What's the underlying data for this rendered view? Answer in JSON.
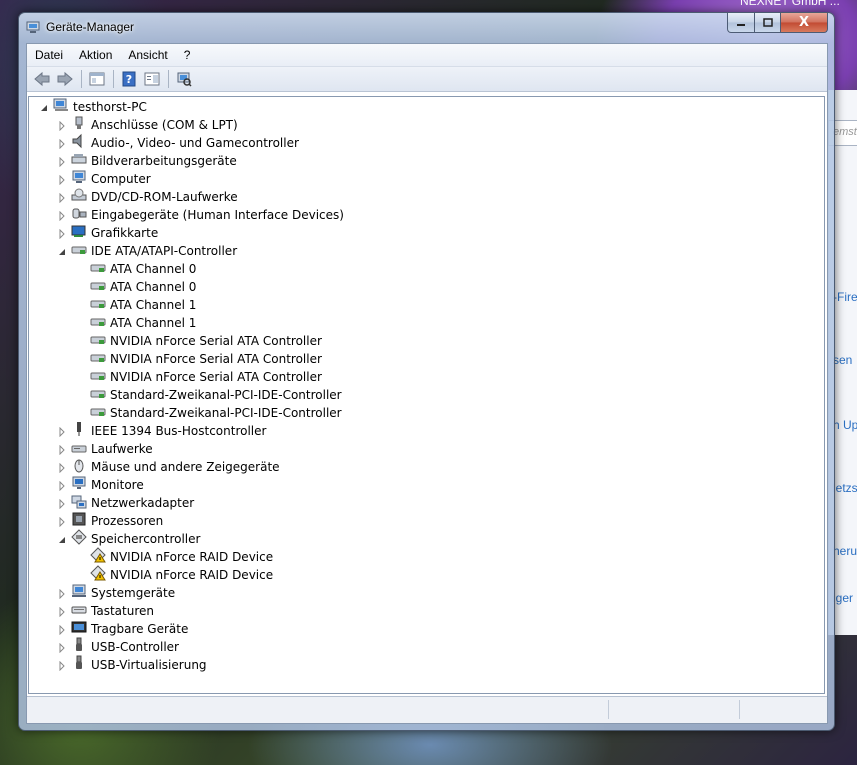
{
  "window": {
    "title": "Geräte-Manager",
    "caption_buttons": {
      "minimize": "–",
      "maximize": "□",
      "close": "X"
    }
  },
  "menu": [
    "Datei",
    "Aktion",
    "Ansicht",
    "?"
  ],
  "toolbar": {
    "buttons": [
      "back-arrow-icon",
      "forward-arrow-icon",
      "console-tree-icon",
      "help-icon",
      "properties-icon",
      "scan-hardware-icon"
    ]
  },
  "tree": {
    "root": "testhorst-PC",
    "items": [
      {
        "label": "Anschlüsse (COM & LPT)",
        "expanded": false,
        "icon": "port-icon",
        "children": []
      },
      {
        "label": "Audio-, Video- und Gamecontroller",
        "expanded": false,
        "icon": "speaker-icon",
        "children": []
      },
      {
        "label": "Bildverarbeitungsgeräte",
        "expanded": false,
        "icon": "scanner-icon",
        "children": []
      },
      {
        "label": "Computer",
        "expanded": false,
        "icon": "computer-icon",
        "children": []
      },
      {
        "label": "DVD/CD-ROM-Laufwerke",
        "expanded": false,
        "icon": "disc-drive-icon",
        "children": []
      },
      {
        "label": "Eingabegeräte (Human Interface Devices)",
        "expanded": false,
        "icon": "hid-icon",
        "children": []
      },
      {
        "label": "Grafikkarte",
        "expanded": false,
        "icon": "display-adapter-icon",
        "children": []
      },
      {
        "label": "IDE ATA/ATAPI-Controller",
        "expanded": true,
        "icon": "ide-controller-icon",
        "children": [
          "ATA Channel 0",
          "ATA Channel 0",
          "ATA Channel 1",
          "ATA Channel 1",
          "NVIDIA nForce Serial ATA Controller",
          "NVIDIA nForce Serial ATA Controller",
          "NVIDIA nForce Serial ATA Controller",
          "Standard-Zweikanal-PCI-IDE-Controller",
          "Standard-Zweikanal-PCI-IDE-Controller"
        ]
      },
      {
        "label": "IEEE 1394 Bus-Hostcontroller",
        "expanded": false,
        "icon": "firewire-icon",
        "children": []
      },
      {
        "label": "Laufwerke",
        "expanded": false,
        "icon": "hard-drive-icon",
        "children": []
      },
      {
        "label": "Mäuse und andere Zeigegeräte",
        "expanded": false,
        "icon": "mouse-icon",
        "children": []
      },
      {
        "label": "Monitore",
        "expanded": false,
        "icon": "monitor-icon",
        "children": []
      },
      {
        "label": "Netzwerkadapter",
        "expanded": false,
        "icon": "network-adapter-icon",
        "children": []
      },
      {
        "label": "Prozessoren",
        "expanded": false,
        "icon": "processor-icon",
        "children": []
      },
      {
        "label": "Speichercontroller",
        "expanded": true,
        "icon": "storage-controller-icon",
        "children_warning": true,
        "children": [
          "NVIDIA nForce RAID Device",
          "NVIDIA nForce RAID Device"
        ]
      },
      {
        "label": "Systemgeräte",
        "expanded": false,
        "icon": "system-devices-icon",
        "children": []
      },
      {
        "label": "Tastaturen",
        "expanded": false,
        "icon": "keyboard-icon",
        "children": []
      },
      {
        "label": "Tragbare Geräte",
        "expanded": false,
        "icon": "portable-device-icon",
        "children": []
      },
      {
        "label": "USB-Controller",
        "expanded": false,
        "icon": "usb-icon",
        "children": []
      },
      {
        "label": "USB-Virtualisierung",
        "expanded": false,
        "icon": "usb-icon",
        "children": []
      }
    ]
  },
  "background": {
    "top_text": "NEXNET GmbH ...",
    "search_placeholder": "emste",
    "fragments": [
      "-Fire",
      "sen",
      "h Up",
      "letzs",
      "heru",
      "iger"
    ]
  },
  "colors": {
    "accent": "#2a6fc2",
    "ide_icon": "#3c9a3c",
    "warning": "#e8b800"
  }
}
